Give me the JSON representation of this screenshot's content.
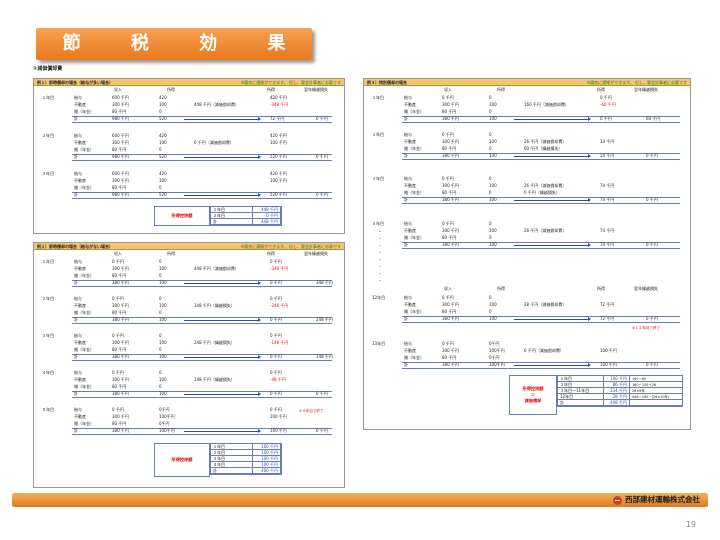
{
  "title": "節 税 効 果",
  "subtitle": "①減価償却費",
  "panel1": {
    "heading": "例１）即時償却の場合（給与が多い場合）",
    "note": "※優良に通帳ができます。 但し、要会計事者に必要です",
    "col_headers": [
      "収入",
      "所得",
      "所得",
      "翌年繰越損失"
    ],
    "years": [
      {
        "year": "１年目",
        "items": [
          "給与",
          "不動産",
          "雑（年金）"
        ],
        "income": [
          "600",
          "300",
          "80"
        ],
        "shotoku1": [
          "420",
          "100",
          "0"
        ],
        "mid": "448 千円（減価償却費）",
        "shotoku2": [
          "420",
          "-348"
        ],
        "total_label": "計",
        "total_income": "980",
        "total1": "520",
        "total2": "72",
        "carry": "0"
      },
      {
        "year": "２年目",
        "items": [
          "給与",
          "不動産",
          "雑（年金）"
        ],
        "income": [
          "600",
          "300",
          "80"
        ],
        "shotoku1": [
          "420",
          "100",
          "0"
        ],
        "mid": "0 千円（減価償却費）",
        "shotoku2": [
          "420",
          "100"
        ],
        "total_label": "計",
        "total_income": "980",
        "total1": "520",
        "total2": "520",
        "carry": "0"
      },
      {
        "year": "３年目",
        "items": [
          "給与",
          "不動産",
          "雑（年金）"
        ],
        "income": [
          "600",
          "300",
          "80"
        ],
        "shotoku1": [
          "420",
          "100",
          "0"
        ],
        "mid": "",
        "shotoku2": [
          "420",
          "100"
        ],
        "total_label": "計",
        "total_income": "980",
        "total1": "520",
        "total2": "520",
        "carry": "0"
      }
    ],
    "deduction_label": "所得控除額",
    "deduction_rows": [
      [
        "１年目",
        "448"
      ],
      [
        "２年目",
        "0"
      ],
      [
        "計",
        "448"
      ]
    ]
  },
  "panel2": {
    "heading": "例２）即時償却の場合（給与がない場合）",
    "note": "※優良に通帳ができます。 但し、要会計事者に必要です",
    "col_headers": [
      "収入",
      "所得",
      "所得",
      "翌年繰越損失"
    ],
    "years": [
      {
        "year": "１年目",
        "items": [
          "給与",
          "不動産",
          "雑（年金）"
        ],
        "income": [
          "0",
          "300",
          "80"
        ],
        "shotoku1": [
          "0",
          "100",
          "0"
        ],
        "mid": "448 千円（減価償却費）",
        "shotoku2": [
          "0",
          "-348"
        ],
        "total_label": "計",
        "total_income": "380",
        "total1": "100",
        "total2": "0",
        "carry": "348"
      },
      {
        "year": "２年目",
        "items": [
          "給与",
          "不動産",
          "雑（年金）"
        ],
        "income": [
          "0",
          "300",
          "80"
        ],
        "shotoku1": [
          "0",
          "100",
          "0"
        ],
        "mid": "348 千円（繰越損失）",
        "shotoku2": [
          "0",
          "-248"
        ],
        "total_label": "計",
        "total_income": "380",
        "total1": "100",
        "total2": "0",
        "carry": "248"
      },
      {
        "year": "３年目",
        "items": [
          "給与",
          "不動産",
          "雑（年金）"
        ],
        "income": [
          "0",
          "300",
          "80"
        ],
        "shotoku1": [
          "0",
          "100",
          "0"
        ],
        "mid": "248 千円（繰越損失）",
        "shotoku2": [
          "0",
          "-148"
        ],
        "total_label": "計",
        "total_income": "380",
        "total1": "100",
        "total2": "0",
        "carry": "148"
      },
      {
        "year": "４年目",
        "items": [
          "給与",
          "不動産",
          "雑（年金）"
        ],
        "income": [
          "0",
          "300",
          "80"
        ],
        "shotoku1": [
          "0",
          "100",
          "0"
        ],
        "mid": "148 千円（繰越損失）",
        "shotoku2": [
          "0",
          "-48"
        ],
        "total_label": "計",
        "total_income": "380",
        "total1": "100",
        "total2": "0",
        "carry": "0"
      },
      {
        "year": "５年目",
        "items": [
          "給与",
          "不動産",
          "雑（年金）"
        ],
        "income": [
          "0",
          "300",
          "80"
        ],
        "shotoku1": [
          "0千円",
          "100千円",
          "0千円"
        ],
        "mid": "",
        "shotoku2": [
          "0",
          "100"
        ],
        "total_label": "計",
        "total_income": "380",
        "total1": "100千円",
        "total2": "100",
        "carry": "0"
      }
    ],
    "note_year4": "※４年目で終了",
    "deduction_label": "所得控除額",
    "deduction_rows": [
      [
        "１年目",
        "100"
      ],
      [
        "２年目",
        "100"
      ],
      [
        "３年目",
        "100"
      ],
      [
        "４年目",
        "100"
      ],
      [
        "計",
        "400"
      ]
    ]
  },
  "panel3": {
    "heading": "例３）特別償却の場合",
    "note": "※優良に通帳ができます。 但し、要会計事者に必要です",
    "col_headers": [
      "収入",
      "所得",
      "所得",
      "翌年繰越損失"
    ],
    "years": [
      {
        "year": "１年目",
        "items": [
          "給与",
          "不動産",
          "雑（年金）"
        ],
        "income": [
          "0",
          "300",
          "80"
        ],
        "shotoku1": [
          "0",
          "100",
          "0"
        ],
        "mid": "160 千円（減価償却費）",
        "shotoku2": [
          "0",
          "-60"
        ],
        "total_label": "計",
        "total_income": "380",
        "total1": "100",
        "total2": "0",
        "carry": "60"
      },
      {
        "year": "２年目",
        "items": [
          "給与",
          "不動産",
          "雑（年金）"
        ],
        "income": [
          "0",
          "300",
          "80"
        ],
        "shotoku1": [
          "0",
          "100",
          "0"
        ],
        "mid": "26 千円（減価償却費）",
        "mid2": "60 千円（繰越損失）",
        "shotoku2": [
          "",
          "14"
        ],
        "total_label": "計",
        "total_income": "380",
        "total1": "100",
        "total2": "14",
        "carry": "0"
      },
      {
        "year": "３年目",
        "items": [
          "給与",
          "不動産",
          "雑（年金）"
        ],
        "income": [
          "0",
          "300",
          "80"
        ],
        "shotoku1": [
          "0",
          "100",
          "0"
        ],
        "mid": "26 千円（減価償却費）",
        "mid2": "0 千円（繰越損失）",
        "shotoku2": [
          "",
          "74"
        ],
        "total_label": "計",
        "total_income": "380",
        "total1": "100",
        "total2": "74",
        "carry": "0"
      },
      {
        "year": "４年目",
        "items": [
          "給与",
          "不動産",
          "雑（年金）"
        ],
        "income": [
          "0",
          "300",
          "80"
        ],
        "shotoku1": [
          "0",
          "100",
          "0"
        ],
        "mid": "26 千円（減価償却費）",
        "shotoku2": [
          "",
          "74"
        ],
        "total_label": "計",
        "total_income": "380",
        "total1": "100",
        "total2": "74",
        "carry": "0"
      },
      {
        "year": "12年目",
        "items": [
          "給与",
          "不動産",
          "雑（年金）"
        ],
        "income": [
          "0",
          "300",
          "80"
        ],
        "shotoku1": [
          "0",
          "100",
          "0"
        ],
        "mid": "28 千円（減価償却費）",
        "shotoku2": [
          "",
          "72"
        ],
        "total_label": "計",
        "total_income": "380",
        "total1": "100",
        "total2": "72",
        "carry": "0"
      },
      {
        "year": "13年目",
        "items": [
          "給与",
          "不動産",
          "雑（年金）"
        ],
        "income": [
          "0",
          "300",
          "80"
        ],
        "shotoku1": [
          "0千円",
          "100千円",
          "0千円"
        ],
        "mid": "0 千円（減価償却費）",
        "shotoku2": [
          "",
          "100"
        ],
        "total_label": "計",
        "total_income": "380",
        "total1": "100千円",
        "total2": "100",
        "carry": "0"
      }
    ],
    "note_year12": "※１２年目で終了",
    "deduction_label_1": "所得控除額",
    "deduction_label_2": "＝",
    "deduction_label_3": "減価償却",
    "deduction_rows": [
      [
        "１年目",
        "100",
        "160－60"
      ],
      [
        "２年目",
        "86",
        "160－100＋26"
      ],
      [
        "３年目～11年目",
        "234",
        "26×9年"
      ],
      [
        "12年目",
        "28",
        "448－160－(26×10年)"
      ],
      [
        "計",
        "448",
        ""
      ]
    ],
    "col_headers_mid": [
      "収入",
      "所得",
      "所得",
      "翌年繰越損失"
    ]
  },
  "unit": "千円",
  "company": "西部建材運輸株式会社",
  "page_number": "19"
}
